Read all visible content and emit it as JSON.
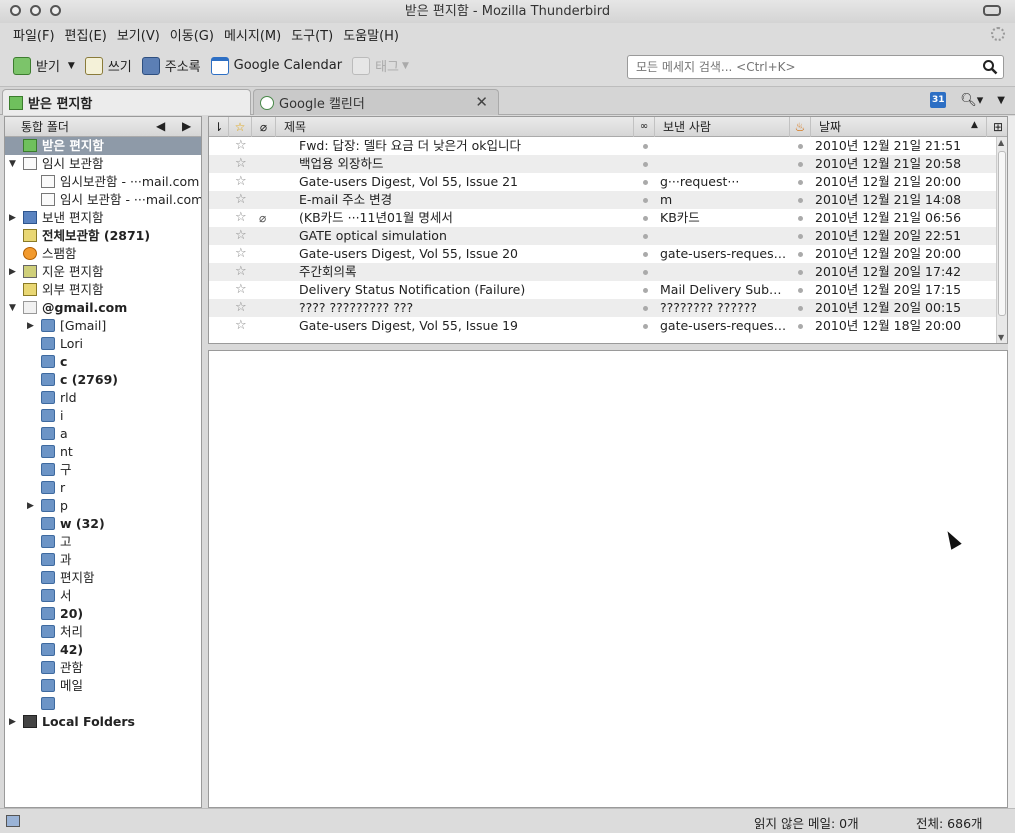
{
  "window": {
    "title": "받은 편지함 - Mozilla Thunderbird"
  },
  "menu": [
    "파일(F)",
    "편집(E)",
    "보기(V)",
    "이동(G)",
    "메시지(M)",
    "도구(T)",
    "도움말(H)"
  ],
  "toolbar": {
    "get": "받기",
    "write": "쓰기",
    "addressbook": "주소록",
    "calendar": "Google Calendar",
    "tag": "태그"
  },
  "search": {
    "placeholder": "모든 메세지 검색... <Ctrl+K>"
  },
  "tabs": [
    {
      "label": "받은 편지함"
    },
    {
      "label": "Google 캘린더"
    }
  ],
  "tab_right": {
    "calendar_badge": "31"
  },
  "folderpane": {
    "header": "통합 폴더",
    "folders": [
      {
        "label": "받은 편지함",
        "icon": "inbox-icon",
        "selected": true,
        "bold": true,
        "indent": 0,
        "twisty": ""
      },
      {
        "label": "임시 보관함",
        "icon": "draft-icon",
        "indent": 0,
        "twisty": "▼"
      },
      {
        "label": "임시보관함 - ···mail.com",
        "icon": "draft-icon",
        "indent": 1,
        "twisty": ""
      },
      {
        "label": "임시 보관함 - ···mail.com",
        "icon": "draft-icon",
        "indent": 1,
        "twisty": ""
      },
      {
        "label": "보낸 편지함",
        "icon": "sent-icon",
        "indent": 0,
        "twisty": "▶"
      },
      {
        "label": "전체보관함 (2871)",
        "icon": "archive-icon",
        "bold": true,
        "indent": 0,
        "twisty": ""
      },
      {
        "label": "스팸함",
        "icon": "junk-icon",
        "indent": 0,
        "twisty": ""
      },
      {
        "label": "지운 편지함",
        "icon": "trash-icon",
        "indent": 0,
        "twisty": "▶"
      },
      {
        "label": "외부 편지함",
        "icon": "outbox-icon",
        "indent": 0,
        "twisty": ""
      },
      {
        "label": "@gmail.com",
        "icon": "account-mail-icon",
        "bold": true,
        "indent": 0,
        "twisty": "▼"
      },
      {
        "label": "[Gmail]",
        "icon": "folder-icon",
        "indent": 1,
        "twisty": "▶"
      },
      {
        "label": "Lori",
        "icon": "folder-icon",
        "indent": 1,
        "twisty": ""
      },
      {
        "label": "c",
        "icon": "folder-icon",
        "bold": true,
        "indent": 1,
        "twisty": ""
      },
      {
        "label": "c (2769)",
        "icon": "folder-icon",
        "bold": true,
        "indent": 1,
        "twisty": ""
      },
      {
        "label": "rld",
        "icon": "folder-icon",
        "indent": 1,
        "twisty": ""
      },
      {
        "label": "i",
        "icon": "folder-icon",
        "indent": 1,
        "twisty": ""
      },
      {
        "label": "a",
        "icon": "folder-icon",
        "indent": 1,
        "twisty": ""
      },
      {
        "label": "nt",
        "icon": "folder-icon",
        "indent": 1,
        "twisty": ""
      },
      {
        "label": "구",
        "icon": "folder-icon",
        "indent": 1,
        "twisty": ""
      },
      {
        "label": "r",
        "icon": "folder-icon",
        "indent": 1,
        "twisty": ""
      },
      {
        "label": "p",
        "icon": "folder-icon",
        "indent": 1,
        "twisty": "▶"
      },
      {
        "label": "w (32)",
        "icon": "folder-icon",
        "bold": true,
        "indent": 1,
        "twisty": ""
      },
      {
        "label": "고",
        "icon": "folder-icon",
        "indent": 1,
        "twisty": ""
      },
      {
        "label": "과",
        "icon": "folder-icon",
        "indent": 1,
        "twisty": ""
      },
      {
        "label": "편지함",
        "icon": "folder-icon",
        "indent": 1,
        "twisty": ""
      },
      {
        "label": "서",
        "icon": "folder-icon",
        "indent": 1,
        "twisty": ""
      },
      {
        "label": "20)",
        "icon": "folder-icon",
        "bold": true,
        "indent": 1,
        "twisty": ""
      },
      {
        "label": "처리",
        "icon": "folder-icon",
        "indent": 1,
        "twisty": ""
      },
      {
        "label": "42)",
        "icon": "folder-icon",
        "bold": true,
        "indent": 1,
        "twisty": ""
      },
      {
        "label": "관함",
        "icon": "folder-icon",
        "indent": 1,
        "twisty": ""
      },
      {
        "label": "메일",
        "icon": "folder-icon",
        "indent": 1,
        "twisty": ""
      },
      {
        "label": "",
        "icon": "folder-icon",
        "indent": 1,
        "twisty": ""
      },
      {
        "label": "Local Folders",
        "icon": "computer-icon",
        "bold": true,
        "indent": 0,
        "twisty": "▶"
      }
    ]
  },
  "threadpane": {
    "columns": {
      "subject": "제목",
      "sender": "보낸 사람",
      "date": "날짜"
    },
    "messages": [
      {
        "subject": "Fwd: 답장: 델타 요금 더 낮은거 ok입니다",
        "sender": "",
        "date": "2010년 12월 21일 21:51",
        "attach": false
      },
      {
        "subject": "백업용 외장하드",
        "sender": "",
        "date": "2010년 12월 21일 20:58",
        "attach": false
      },
      {
        "subject": "Gate-users Digest, Vol 55, Issue 21",
        "sender": "g···request···",
        "date": "2010년 12월 21일 20:00",
        "attach": false
      },
      {
        "subject": "E-mail 주소 변경",
        "sender": "m",
        "date": "2010년 12월 21일 14:08",
        "attach": false
      },
      {
        "subject": "(KB카드 ···11년01월 명세서",
        "sender": "KB카드",
        "date": "2010년 12월 21일 06:56",
        "attach": true
      },
      {
        "subject": "GATE optical simulation",
        "sender": "",
        "date": "2010년 12월 20일 22:51",
        "attach": false
      },
      {
        "subject": "Gate-users Digest, Vol 55, Issue 20",
        "sender": "gate-users-request···",
        "date": "2010년 12월 20일 20:00",
        "attach": false
      },
      {
        "subject": "주간회의록",
        "sender": "",
        "date": "2010년 12월 20일 17:42",
        "attach": false
      },
      {
        "subject": "Delivery Status Notification (Failure)",
        "sender": "Mail Delivery Subsy···",
        "date": "2010년 12월 20일 17:15",
        "attach": false
      },
      {
        "subject": "???? ????????? ???",
        "sender": "???????? ??????",
        "date": "2010년 12월 20일 00:15",
        "attach": false
      },
      {
        "subject": "Gate-users Digest, Vol 55, Issue 19",
        "sender": "gate-users-request···",
        "date": "2010년 12월 18일 20:00",
        "attach": false
      }
    ]
  },
  "status": {
    "unread": "읽지 않은 메일: 0개",
    "total": "전체: 686개"
  },
  "colors": {
    "selection": "#8e9aa8",
    "folder": "#6c94c6",
    "chrome": "#dcdcdc"
  }
}
